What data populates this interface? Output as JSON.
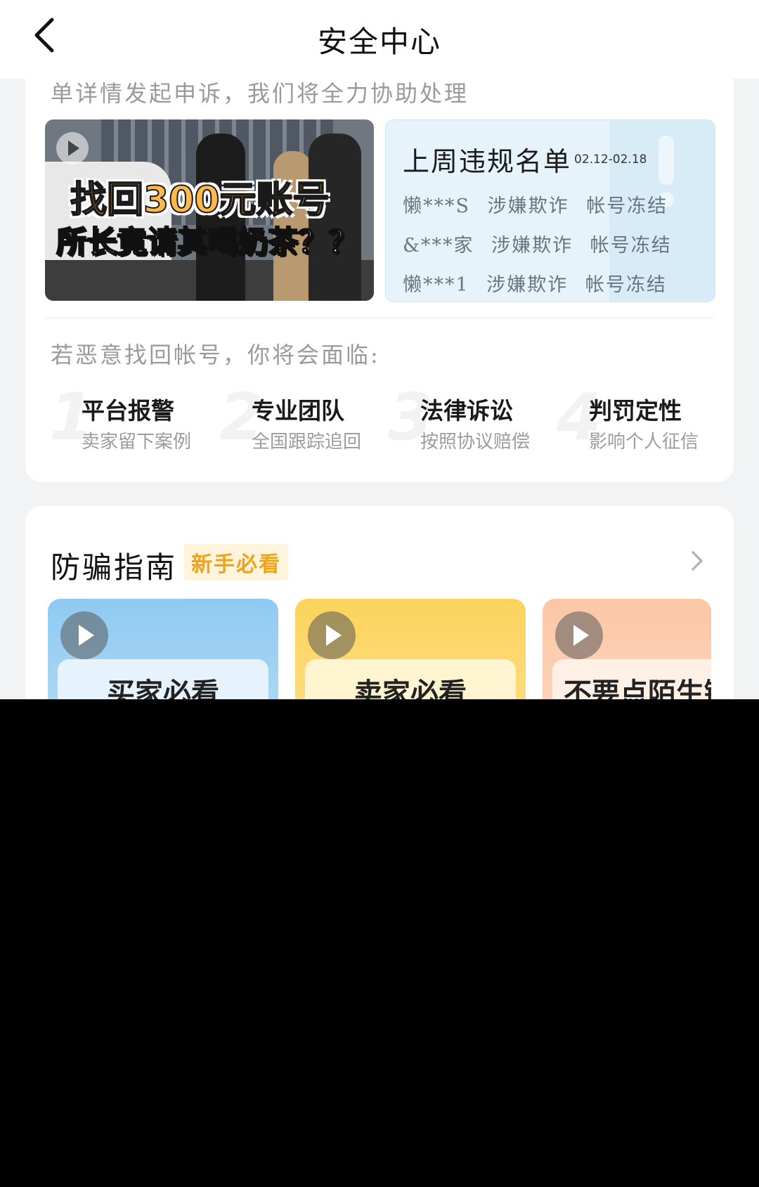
{
  "header": {
    "title": "安全中心"
  },
  "appeal": {
    "text": "单详情发起申诉，我们将全力协助处理"
  },
  "video": {
    "headline": "找回300元账号",
    "subline": "所长竟请其喝奶茶？？"
  },
  "violation_list": {
    "title": "上周违规名单",
    "date_range": "02.12-02.18",
    "rows": [
      {
        "user": "懒***S",
        "reason": "涉嫌欺诈",
        "action": "帐号冻结"
      },
      {
        "user": "&***家",
        "reason": "涉嫌欺诈",
        "action": "帐号冻结"
      },
      {
        "user": "懒***1",
        "reason": "涉嫌欺诈",
        "action": "帐号冻结"
      }
    ]
  },
  "risks": {
    "intro": "若恶意找回帐号，你将会面临:",
    "items": [
      {
        "num": "1",
        "title": "平台报警",
        "sub": "卖家留下案例"
      },
      {
        "num": "2",
        "title": "专业团队",
        "sub": "全国跟踪追回"
      },
      {
        "num": "3",
        "title": "法律诉讼",
        "sub": "按照协议赔偿"
      },
      {
        "num": "4",
        "title": "判罚定性",
        "sub": "影响个人征信"
      }
    ]
  },
  "guide": {
    "title": "防骗指南",
    "badge": "新手必看",
    "cards": [
      {
        "label": "买家必看"
      },
      {
        "label": "卖家必看"
      },
      {
        "label": "不要点陌生链"
      }
    ]
  },
  "icons": [
    "back-arrow-icon",
    "play-icon",
    "chevron-right-icon"
  ]
}
